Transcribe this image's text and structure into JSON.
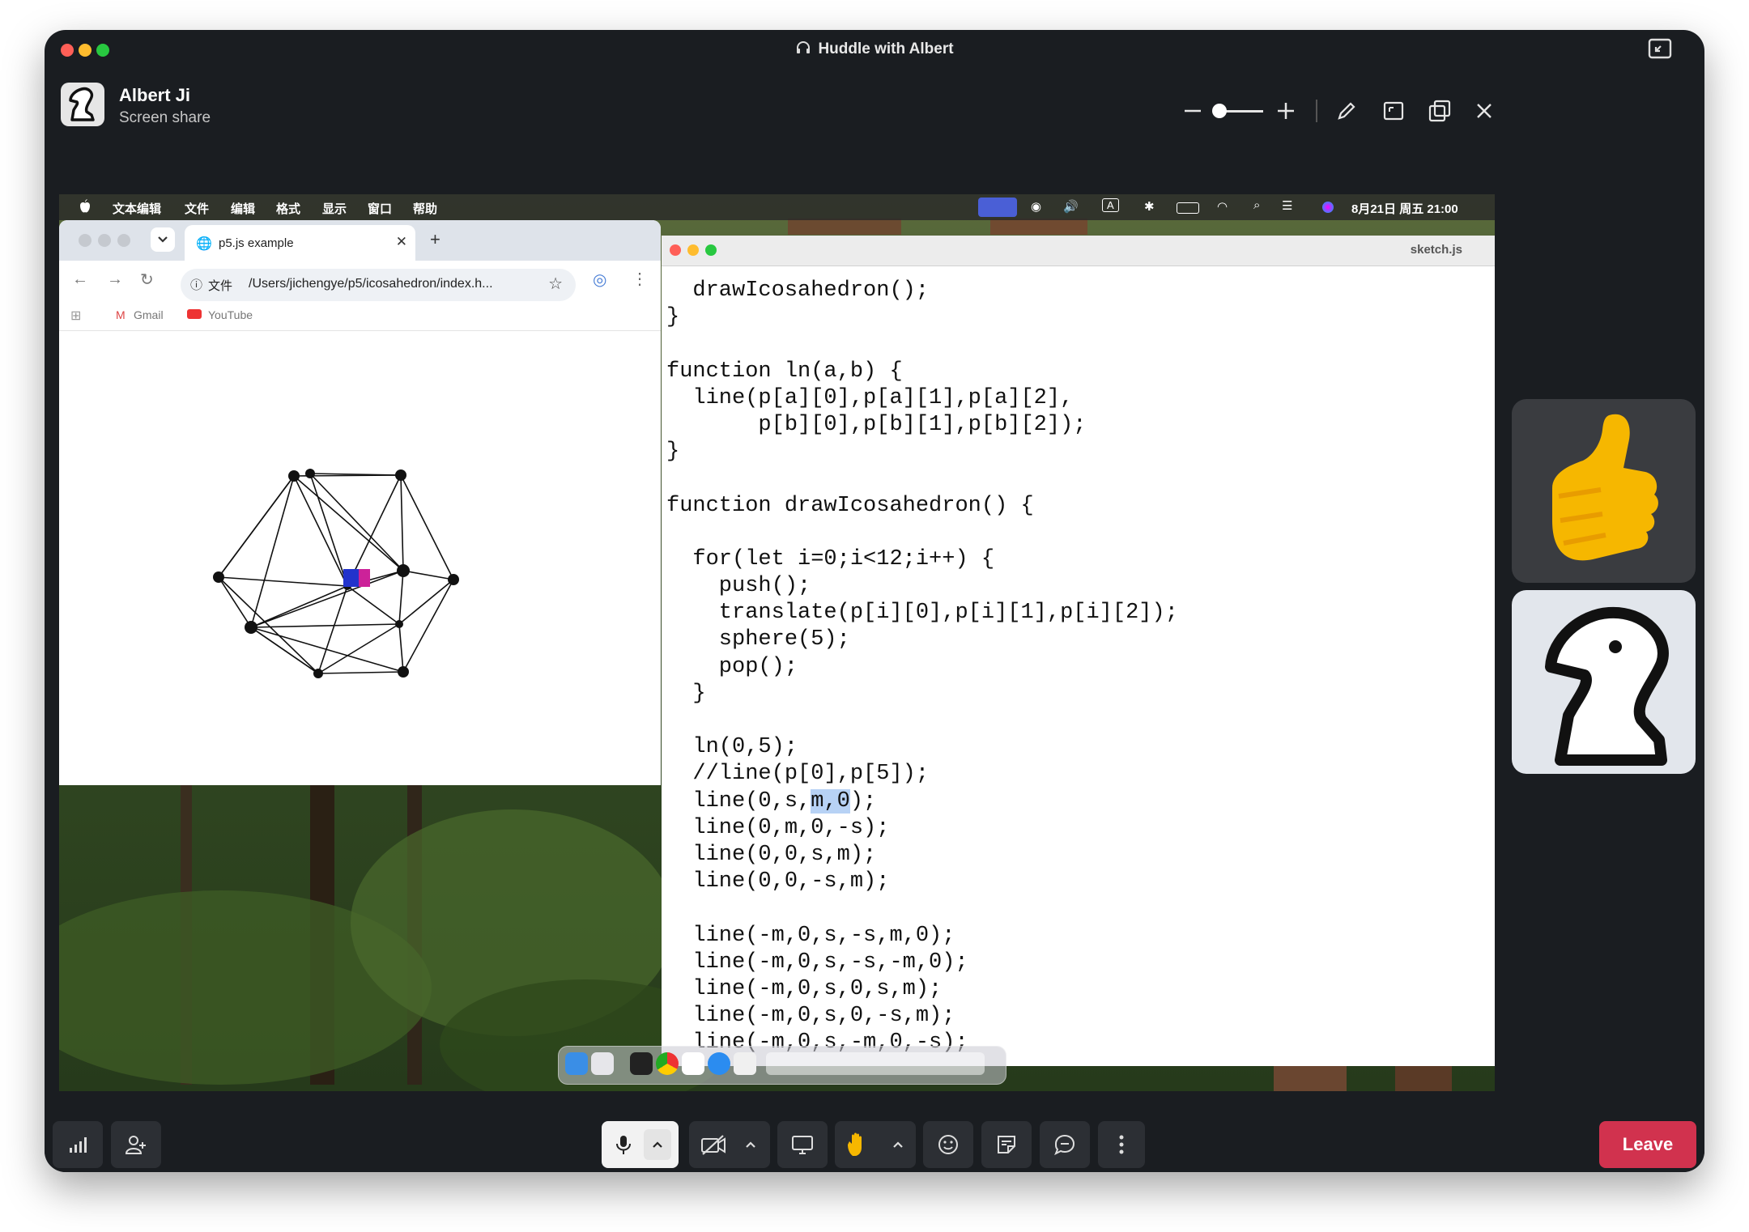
{
  "window": {
    "title": "Huddle with Albert"
  },
  "presenter": {
    "name": "Albert Ji",
    "status": "Screen share"
  },
  "share_controls": {
    "icons": [
      "zoom-out-icon",
      "zoom-slider",
      "zoom-in-icon",
      "pencil-icon",
      "fit-screen-icon",
      "popout-icon",
      "close-icon"
    ]
  },
  "mac_menubar": {
    "menus": [
      "文本编辑",
      "文件",
      "编辑",
      "格式",
      "显示",
      "窗口",
      "帮助"
    ],
    "clock": "8月21日 周五 21:00"
  },
  "browser": {
    "tab_title": "p5.js example",
    "security_label": "文件",
    "url": "/Users/jichengye/p5/icosahedron/index.h...",
    "bookmarks": [
      "Gmail",
      "YouTube"
    ]
  },
  "editor": {
    "filename": "sketch.js",
    "code_lines": [
      "  drawIcosahedron();",
      "}",
      "",
      "function ln(a,b) {",
      "  line(p[a][0],p[a][1],p[a][2],",
      "       p[b][0],p[b][1],p[b][2]);",
      "}",
      "",
      "function drawIcosahedron() {",
      "",
      "  for(let i=0;i<12;i++) {",
      "    push();",
      "    translate(p[i][0],p[i][1],p[i][2]);",
      "    sphere(5);",
      "    pop();",
      "  }",
      "",
      "  ln(0,5);",
      "  //line(p[0],p[5]);",
      "  line(0,s,m,0);",
      "  line(0,m,0,-s);",
      "  line(0,0,s,m);",
      "  line(0,0,-s,m);",
      "",
      "  line(-m,0,s,-s,m,0);",
      "  line(-m,0,s,-s,-m,0);",
      "  line(-m,0,s,0,s,m);",
      "  line(-m,0,s,0,-s,m);",
      "  line(-m,0,s,-m,0,-s);"
    ],
    "highlight": "m,0"
  },
  "controls": {
    "leave_label": "Leave"
  },
  "colors": {
    "window_bg": "#1a1d21",
    "leave": "#d1324e",
    "accent": "#4a5fd6"
  }
}
